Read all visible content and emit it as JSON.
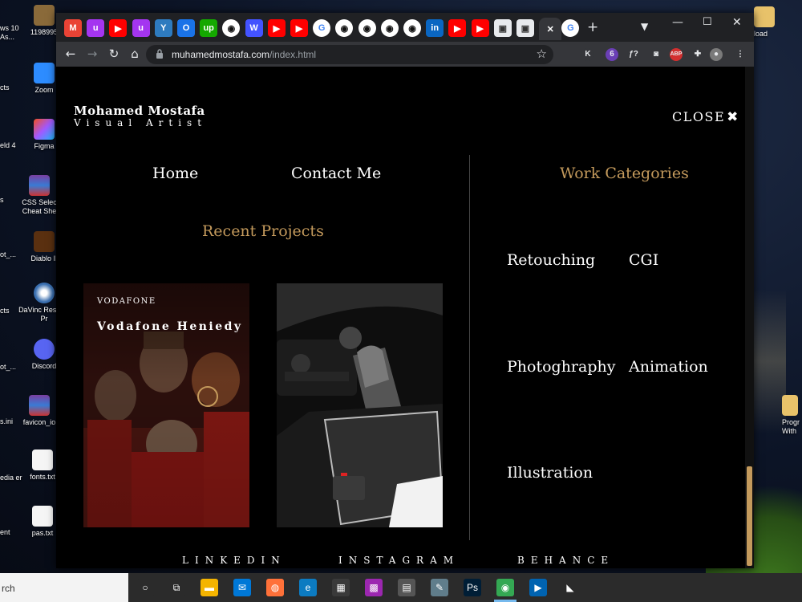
{
  "desktop": {
    "icons_left": [
      {
        "label": "Zoom"
      },
      {
        "label": "eld 4"
      },
      {
        "label": "Figma"
      },
      {
        "label": "CSS Selec Cheat She"
      },
      {
        "label": "Diablo II"
      },
      {
        "label": "DaVinc Resolve Pr"
      },
      {
        "label": "Discord"
      },
      {
        "label": "favicon_io"
      },
      {
        "label": "fonts.txt"
      },
      {
        "label": "pas.txt"
      }
    ],
    "icons_partial": [
      {
        "label": "ws 10 As..."
      },
      {
        "label": "1198995"
      },
      {
        "label": "cts"
      },
      {
        "label": "s"
      },
      {
        "label": "ot_..."
      },
      {
        "label": "ot_..."
      },
      {
        "label": "s.ini"
      },
      {
        "label": "edia er"
      },
      {
        "label": "ent"
      }
    ],
    "icons_right": [
      {
        "label": "load"
      },
      {
        "label": "Progr With"
      }
    ]
  },
  "browser": {
    "tabs": [
      {
        "icon": "gmail-icon",
        "glyph": "M",
        "color": "#ea4335"
      },
      {
        "icon": "udemy-icon",
        "glyph": "u",
        "color": "#a435f0"
      },
      {
        "icon": "youtube-icon",
        "glyph": "▶",
        "color": "#ff0000"
      },
      {
        "icon": "udemy-icon",
        "glyph": "u",
        "color": "#a435f0"
      },
      {
        "icon": "testing-icon",
        "glyph": "Y",
        "color": "#2e7bbf"
      },
      {
        "icon": "circle-icon",
        "glyph": "O",
        "color": "#1a73e8"
      },
      {
        "icon": "upwork-icon",
        "glyph": "up",
        "color": "#14a800"
      },
      {
        "icon": "github-icon",
        "glyph": "◉",
        "color": "#444"
      },
      {
        "icon": "webflow-icon",
        "glyph": "W",
        "color": "#4353ff"
      },
      {
        "icon": "youtube-icon",
        "glyph": "▶",
        "color": "#ff0000"
      },
      {
        "icon": "youtube-icon",
        "glyph": "▶",
        "color": "#ff0000"
      },
      {
        "icon": "google-icon",
        "glyph": "G",
        "color": "#4285f4"
      },
      {
        "icon": "github-icon",
        "glyph": "◉",
        "color": "#444"
      },
      {
        "icon": "github-icon",
        "glyph": "◉",
        "color": "#444"
      },
      {
        "icon": "github-icon",
        "glyph": "◉",
        "color": "#444"
      },
      {
        "icon": "github-icon",
        "glyph": "◉",
        "color": "#444"
      },
      {
        "icon": "linkedin-icon",
        "glyph": "in",
        "color": "#0a66c2"
      },
      {
        "icon": "youtube-icon",
        "glyph": "▶",
        "color": "#ff0000"
      },
      {
        "icon": "youtube-icon",
        "glyph": "▶",
        "color": "#ff0000"
      },
      {
        "icon": "site-icon",
        "glyph": "▣",
        "color": "#666"
      },
      {
        "icon": "site-icon",
        "glyph": "▣",
        "color": "#666"
      },
      {
        "icon": "close-icon",
        "glyph": "✕",
        "color": "#35363a"
      },
      {
        "icon": "google-icon",
        "glyph": "G",
        "color": "#4285f4"
      }
    ],
    "new_tab": "+",
    "url_host": "muhamedmostafa.com",
    "url_path": "/index.html",
    "extensions": [
      {
        "name": "k-extension-icon",
        "glyph": "K",
        "color": "#35363a"
      },
      {
        "name": "extension-badge-icon",
        "glyph": "6",
        "color": "#6a3fb5"
      },
      {
        "name": "formula-icon",
        "glyph": "ƒ?",
        "color": "#35363a"
      },
      {
        "name": "camera-icon",
        "glyph": "◙",
        "color": "#35363a"
      },
      {
        "name": "adblock-icon",
        "glyph": "ABP",
        "color": "#d32f2f"
      },
      {
        "name": "puzzle-icon",
        "glyph": "✚",
        "color": "#35363a"
      },
      {
        "name": "profile-avatar-icon",
        "glyph": "●",
        "color": "#7a7a7a"
      },
      {
        "name": "menu-dots-icon",
        "glyph": "⋮",
        "color": "#35363a"
      }
    ]
  },
  "site": {
    "logo_name": "Mohamed Mostafa",
    "logo_subtitle": "Visual Artist",
    "close_label": "CLOSE",
    "nav": {
      "home": "Home",
      "contact": "Contact Me"
    },
    "recent_projects_title": "Recent Projects",
    "projects": [
      {
        "brand": "VODAFONE",
        "title": "Vodafone Heniedy"
      },
      {
        "brand": "",
        "title": ""
      }
    ],
    "work_categories_title": "Work Categories",
    "categories": [
      "Retouching",
      "CGI",
      "Photoghraphy",
      "Animation",
      "Illustration"
    ],
    "social": [
      "LINKEDIN",
      "INSTAGRAM",
      "BEHANCE"
    ],
    "accent_color": "#c49a5c"
  },
  "taskbar": {
    "search_text": "rch",
    "icons": [
      {
        "name": "cortana-icon",
        "glyph": "○",
        "color": "#2b2b2b"
      },
      {
        "name": "task-view-icon",
        "glyph": "⧉",
        "color": "#2b2b2b"
      },
      {
        "name": "file-explorer-icon",
        "glyph": "▬",
        "color": "#f4b400"
      },
      {
        "name": "mail-icon",
        "glyph": "✉",
        "color": "#0078d7"
      },
      {
        "name": "firefox-icon",
        "glyph": "◍",
        "color": "#ff7139"
      },
      {
        "name": "edge-icon",
        "glyph": "e",
        "color": "#0c7bc1"
      },
      {
        "name": "store-icon",
        "glyph": "▦",
        "color": "#3a3a3a"
      },
      {
        "name": "color-picker-icon",
        "glyph": "▩",
        "color": "#9c27b0"
      },
      {
        "name": "calculator-icon",
        "glyph": "▤",
        "color": "#555"
      },
      {
        "name": "paint-icon",
        "glyph": "✎",
        "color": "#607d8b"
      },
      {
        "name": "photoshop-icon",
        "glyph": "Ps",
        "color": "#001e36"
      },
      {
        "name": "chrome-icon",
        "glyph": "◉",
        "color": "#34a853"
      },
      {
        "name": "media-icon",
        "glyph": "▶",
        "color": "#0063b1"
      },
      {
        "name": "nvidia-icon",
        "glyph": "◣",
        "color": "#2b2b2b"
      }
    ]
  }
}
